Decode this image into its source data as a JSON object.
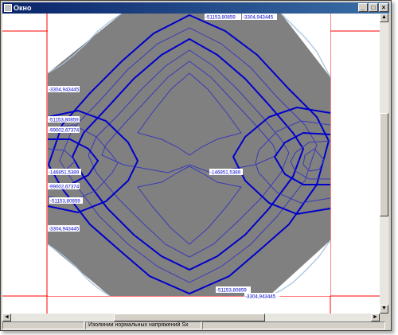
{
  "window": {
    "title": "Окно"
  },
  "titlebar_buttons": {
    "minimize": "_",
    "maximize": "□",
    "close": "×"
  },
  "scroll": {
    "up": "▲",
    "down": "▼",
    "left": "◄",
    "right": "►"
  },
  "status": {
    "pane1": "",
    "pane2": "Изолинии нормальных напряжений Sx",
    "pane3": ""
  },
  "plot": {
    "fill_color": "#808080",
    "isoline_colors": {
      "major": "#0000cc",
      "minor": "#3a3ab8",
      "outer": "#a8c4e0"
    },
    "frame_color": "#ff0000",
    "labels": [
      "-51153,80859",
      "-3304,943445",
      "-3304,943445",
      "-51153,80859",
      "-99002,67374",
      "-146851,5389",
      "-146851,5389",
      "-99002,67374",
      "-51153,80859",
      "-3304,943445",
      "-51153,80859",
      "-3304,943445"
    ]
  }
}
